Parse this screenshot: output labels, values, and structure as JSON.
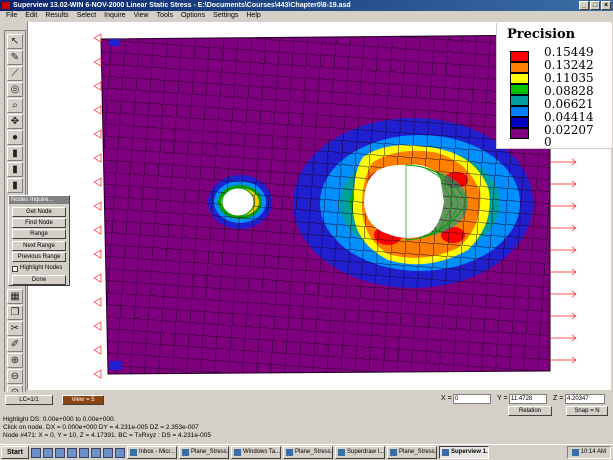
{
  "window": {
    "title": "Superview 13.02-WIN 6-NOV-2000 Linear Static Stress - E:\\Documents\\Courses\\443\\Chapter0\\8-19.asd"
  },
  "menu": [
    "File",
    "Edit",
    "Results",
    "Select",
    "Inquire",
    "View",
    "Tools",
    "Options",
    "Settings",
    "Help"
  ],
  "toolbar_icons": [
    "select-icon",
    "pencil-icon",
    "draw-icon",
    "rotate-icon",
    "zoom-icon",
    "pan-icon",
    "shade-icon",
    "level-icon",
    "level-icon",
    "level-icon",
    "grid-icon",
    "copy-icon",
    "cut-icon",
    "paint-icon",
    "zoom-in-icon",
    "zoom-out-icon",
    "zoom-fit-icon"
  ],
  "legend": {
    "title": "Precision",
    "items": [
      {
        "label": "0.15449",
        "color": "#ff0000"
      },
      {
        "label": "0.13242",
        "color": "#ff8000"
      },
      {
        "label": "0.11035",
        "color": "#ffff00"
      },
      {
        "label": "0.08828",
        "color": "#00c000"
      },
      {
        "label": "0.06621",
        "color": "#00a0a0"
      },
      {
        "label": "0.04414",
        "color": "#0080ff"
      },
      {
        "label": "0.02207",
        "color": "#0000c0"
      },
      {
        "label": "0",
        "color": "#7f007f"
      }
    ]
  },
  "nodes_panel": {
    "title": "Nodes Inquire...",
    "buttons": [
      "Get Node",
      "Find Node",
      "Range",
      "Next Range",
      "Previous Range"
    ],
    "checkbox_label": "Highlight Nodes",
    "done_label": "Done"
  },
  "bottom": {
    "lc_label": "LC=1/1",
    "view_label": "View = 5",
    "x_label": "X =",
    "x_value": "0",
    "y_label": "Y =",
    "y_value": "11.4728",
    "z_label": "Z =",
    "z_value": "4.20347",
    "relation_label": "Relation",
    "snap_label": "Snap = N",
    "info_lines": [
      "Highlight DS: 0.00e+000 to 0.00e+000.",
      "Click on node.       DX = 0.000e+000 DY = 4.231e-005 DZ = 2.353e-007",
      "Node #471: X = 0, Y = 10, Z = 4.17391. BC = TxRxyz : DS = 4.231e-005"
    ]
  },
  "taskbar": {
    "start_label": "Start",
    "tasks": [
      "Inbox - Micr...",
      "Plane_Stress...",
      "Windows Ta...",
      "Plane_Stress...",
      "Superdraw I...",
      "Plane_Stress...",
      "Superview 1..."
    ],
    "active_task_index": 6,
    "clock": "10:14 AM"
  },
  "colors": {
    "titlebar": "#0a246a",
    "mesh_base": "#7f007f",
    "arrow": "#ff2020",
    "hole_mesh": "#00a000"
  }
}
